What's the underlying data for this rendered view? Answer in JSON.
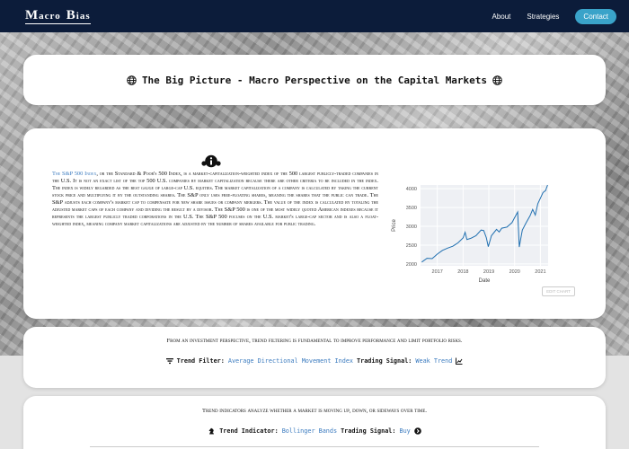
{
  "nav": {
    "logo_m": "M",
    "logo_rest1": "acro",
    "logo_b": "B",
    "logo_rest2": "ias",
    "about": "About",
    "strategies": "Strategies",
    "contact": "Contact"
  },
  "header": {
    "title": "The Big Picture - Macro Perspective on the Capital Markets"
  },
  "info": {
    "link": "The S&P 500 Index",
    "text": ", or the Standard & Poor's 500 Index, is a market-capitalization-weighted index of the 500 largest publicly-traded companies in the U.S. It is not an exact list of the top 500 U.S. companies by market capitalization because there are other criteria to be included in the index. The index is widely regarded as the best gauge of large-cap U.S. equities. The market capitalization of a company is calculated by taking the current stock price and multiplying it by the outstanding shares. The S&P only uses free-floating shares, meaning the shares that the public can trade. The S&P adjusts each company's market cap to compensate for new share issues or company mergers. The value of the index is calculated by totaling the adjusted market caps of each company and dividing the result by a divisor. The S&P 500 is one of the most widely quoted American indexes because it represents the largest publicly traded corporations in the U.S. The S&P 500 focuses on the U.S. market's large-cap sector and is also a float-weighted index, meaning company market capitalizations are adjusted by the number of shares available for public trading.",
    "edit_chart": "EDIT CHART"
  },
  "chart_data": {
    "type": "line",
    "xlabel": "Date",
    "ylabel": "Price",
    "x_ticks": [
      "2017",
      "2018",
      "2019",
      "2020",
      "2021"
    ],
    "y_ticks": [
      2000,
      2500,
      3000,
      3500,
      4000
    ],
    "ylim": [
      1950,
      4100
    ],
    "xlim": [
      2016.35,
      2021.3
    ],
    "grid": true,
    "line_color": "#1f6fb0",
    "series": [
      {
        "x": [
          2016.4,
          2016.6,
          2016.8,
          2016.9,
          2017.0,
          2017.2,
          2017.4,
          2017.6,
          2017.8,
          2018.0,
          2018.08,
          2018.15,
          2018.3,
          2018.5,
          2018.7,
          2018.8,
          2018.9,
          2018.98,
          2019.1,
          2019.3,
          2019.4,
          2019.5,
          2019.7,
          2019.9,
          2020.0,
          2020.12,
          2020.18,
          2020.22,
          2020.3,
          2020.45,
          2020.6,
          2020.7,
          2020.8,
          2020.9,
          2021.0,
          2021.1,
          2021.2,
          2021.28
        ],
        "y": [
          2050,
          2150,
          2140,
          2200,
          2260,
          2360,
          2420,
          2470,
          2560,
          2690,
          2840,
          2650,
          2680,
          2750,
          2900,
          2890,
          2700,
          2460,
          2750,
          2920,
          2850,
          2950,
          2980,
          3100,
          3230,
          3380,
          2450,
          2600,
          2900,
          3100,
          3280,
          3450,
          3300,
          3600,
          3750,
          3900,
          3950,
          4150
        ]
      }
    ]
  },
  "trend_filter": {
    "intro": "From an investment perspective, trend filtering is fundamental to improve performance and limit portfolio risks.",
    "label": "Trend Filter:",
    "value": "Average Directional Movement Index",
    "signal_label": "Trading Signal:",
    "signal_value": "Weak Trend"
  },
  "trend_indicator": {
    "intro": "Trend indicators analyze whether a market is moving up, down, or sideways over time.",
    "label": "Trend Indicator:",
    "value": "Bollinger Bands",
    "signal_label": "Trading Signal:",
    "signal_value": "Buy"
  }
}
